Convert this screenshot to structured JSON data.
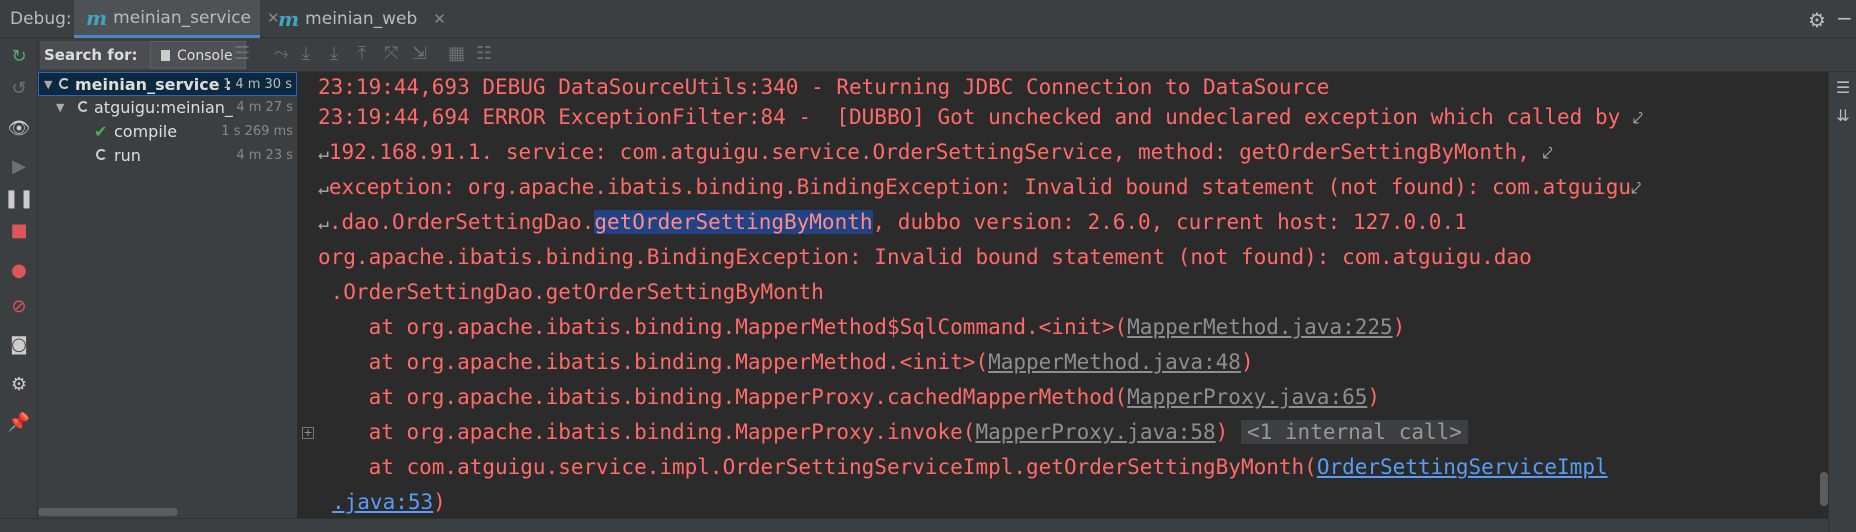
{
  "header": {
    "debug_label": "Debug:",
    "tabs": [
      {
        "label": "meinian_service",
        "icon": "m",
        "active": true
      },
      {
        "label": "meinian_web",
        "icon": "m",
        "active": false
      }
    ],
    "close_glyph": "✕"
  },
  "toolbar": {
    "search_for": "Search for:",
    "console_tab": "Console"
  },
  "tree": {
    "items": [
      {
        "name": "meinian_service :",
        "time": "1 4 m 30 s"
      },
      {
        "name": "atguigu:meinian_",
        "time": "4 m 27 s"
      },
      {
        "name": "compile",
        "time": "1 s 269 ms"
      },
      {
        "name": "run",
        "time": "4 m 23 s"
      }
    ]
  },
  "console": {
    "l1": "23:19:44,693 DEBUG DataSourceUtils:340 - Returning JDBC Connection to DataSource",
    "l2": "23:19:44,694 ERROR ExceptionFilter:84 -  [DUBBO] Got unchecked and undeclared exception which called by",
    "l3": "192.168.91.1. service: com.atguigu.service.OrderSettingService, method: getOrderSettingByMonth,",
    "l4": "exception: org.apache.ibatis.binding.BindingException: Invalid bound statement (not found): com.atguigu",
    "l5_a": ".dao.OrderSettingDao.",
    "l5_hl": "getOrderSettingByMonth",
    "l5_b": ", dubbo version: 2.6.0, current host: 127.0.0.1",
    "l6": "org.apache.ibatis.binding.BindingException: Invalid bound statement (not found): com.atguigu.dao",
    "l7": " .OrderSettingDao.getOrderSettingByMonth",
    "l8_a": "    at org.apache.ibatis.binding.MapperMethod$SqlCommand.<init>(",
    "l8_link": "MapperMethod.java:225",
    "l9_a": "    at org.apache.ibatis.binding.MapperMethod.<init>(",
    "l9_link": "MapperMethod.java:48",
    "l10_a": "    at org.apache.ibatis.binding.MapperProxy.cachedMapperMethod(",
    "l10_link": "MapperProxy.java:65",
    "l11_a": "    at org.apache.ibatis.binding.MapperProxy.invoke(",
    "l11_link": "MapperProxy.java:58",
    "l11_internal": "<1 internal call>",
    "l12_a": "    at com.atguigu.service.impl.OrderSettingServiceImpl.getOrderSettingByMonth(",
    "l12_link": "OrderSettingServiceImpl",
    "l13_link": ".java:53",
    "close_paren": ")",
    "wrap_start": "↵",
    "wrap_end": "⤦"
  },
  "colors": {
    "error_text": "#ff6b68",
    "link": "#589df6",
    "selection": "#214283"
  }
}
